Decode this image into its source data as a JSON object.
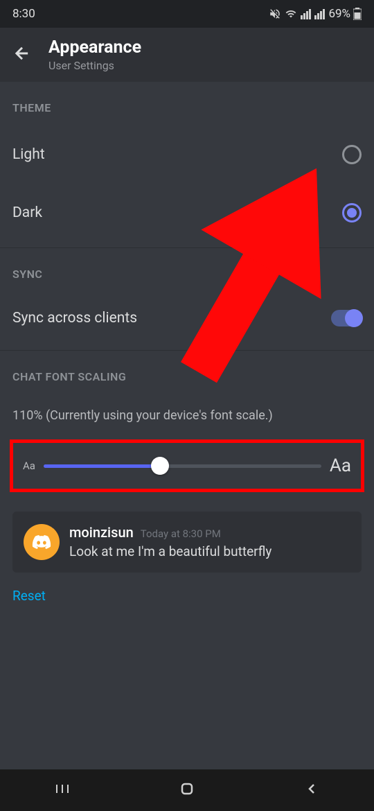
{
  "status": {
    "time": "8:30",
    "battery": "69%"
  },
  "header": {
    "title": "Appearance",
    "subtitle": "User Settings"
  },
  "sections": {
    "theme": {
      "title": "THEME",
      "options": [
        {
          "label": "Light",
          "selected": false
        },
        {
          "label": "Dark",
          "selected": true
        }
      ]
    },
    "sync": {
      "title": "SYNC",
      "toggle_label": "Sync across clients",
      "toggle_on": true
    },
    "font_scaling": {
      "title": "CHAT FONT SCALING",
      "status_text": "110% (Currently using your device's font scale.)",
      "small_label": "Aa",
      "large_label": "Aa",
      "slider_percent": 42
    }
  },
  "preview": {
    "username": "moinzisun",
    "timestamp": "Today at 8:30 PM",
    "message": "Look at me I'm a beautiful butterfly"
  },
  "reset_label": "Reset",
  "annotation": {
    "arrow_color": "#ff0808",
    "highlight_color": "#ff0000"
  }
}
